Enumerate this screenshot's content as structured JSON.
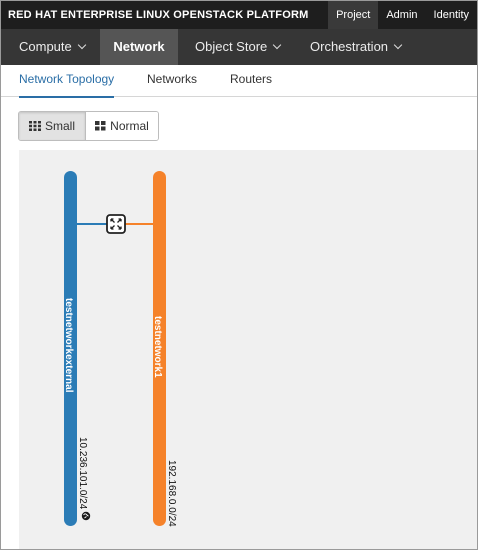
{
  "brand": {
    "name": "RED HAT",
    "product": "ENTERPRISE LINUX OPENSTACK PLATFORM"
  },
  "top_links": [
    {
      "label": "Project",
      "active": true
    },
    {
      "label": "Admin",
      "active": false
    },
    {
      "label": "Identity",
      "active": false
    }
  ],
  "main_nav": [
    {
      "label": "Compute",
      "dropdown": true,
      "active": false
    },
    {
      "label": "Network",
      "dropdown": false,
      "active": true
    },
    {
      "label": "Object Store",
      "dropdown": true,
      "active": false
    },
    {
      "label": "Orchestration",
      "dropdown": true,
      "active": false
    }
  ],
  "sub_tabs": [
    {
      "label": "Network Topology",
      "active": true
    },
    {
      "label": "Networks",
      "active": false
    },
    {
      "label": "Routers",
      "active": false
    }
  ],
  "view_toggle": {
    "small_label": "Small",
    "normal_label": "Normal",
    "selected": "Small"
  },
  "topology": {
    "networks": [
      {
        "name": "testnetworkexternal",
        "cidr": "10.236.101.0/24",
        "color": "#2b7cb6",
        "external_icon": "globe-icon"
      },
      {
        "name": "testnetwork1",
        "cidr": "192.168.0.0/24",
        "color": "#f5822a"
      }
    ],
    "router": {
      "icon": "router-icon"
    }
  },
  "colors": {
    "accent": "#2a6ea6",
    "nav_bg": "#363636",
    "brand_bg": "#1e1e1e"
  }
}
